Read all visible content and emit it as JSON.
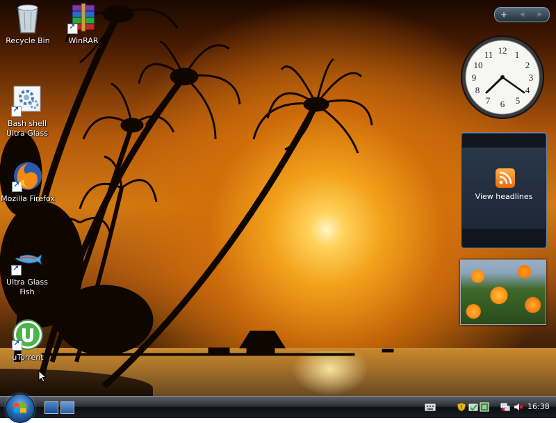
{
  "desktop_icons": [
    {
      "label": "Recycle Bin",
      "icon": "recycle-bin-icon"
    },
    {
      "label": "WinRAR",
      "icon": "winrar-icon"
    },
    {
      "label": "Bash shell\nUltra Glass",
      "icon": "gear-icon"
    },
    {
      "label": "Mozilla Firefox",
      "icon": "firefox-icon"
    },
    {
      "label": "Ultra Glass\nFish",
      "icon": "fish-icon"
    },
    {
      "label": "uTorrent",
      "icon": "utorrent-icon"
    }
  ],
  "gadgets": {
    "toolbar": {
      "add_label": "+",
      "prev_label": "◀",
      "next_label": "▶"
    },
    "clock": {
      "numbers": [
        "12",
        "1",
        "2",
        "3",
        "4",
        "5",
        "6",
        "7",
        "8",
        "9",
        "10",
        "11"
      ],
      "time": "16:38"
    },
    "feed": {
      "text": "View headlines",
      "icon": "rss-icon"
    },
    "slideshow": {
      "subject": "orange flowers photo"
    }
  },
  "taskbar": {
    "start_button": "windows-orb-icon",
    "quick_launch": [
      "show-desktop-icon",
      "switch-windows-icon"
    ],
    "tray_icons": [
      "keyboard-icon",
      "security-shield-icon",
      "safely-remove-icon",
      "network-icon",
      "volume-muted-icon"
    ],
    "clock": "16:38"
  }
}
